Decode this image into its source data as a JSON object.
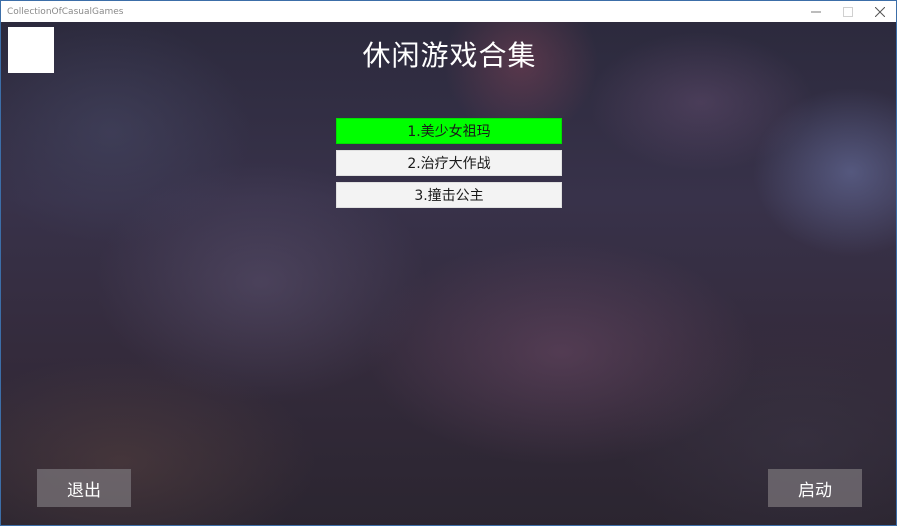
{
  "window": {
    "title": "CollectionOfCasualGames"
  },
  "header": {
    "title": "休闲游戏合集"
  },
  "games": {
    "items": [
      {
        "label": "1.美少女祖玛",
        "selected": true
      },
      {
        "label": "2.治疗大作战",
        "selected": false
      },
      {
        "label": "3.撞击公主",
        "selected": false
      }
    ]
  },
  "actions": {
    "exit_label": "退出",
    "start_label": "启动"
  },
  "colors": {
    "selected": "#00ff00",
    "unselected": "#f3f3f3",
    "button_bg": "#78737a"
  }
}
